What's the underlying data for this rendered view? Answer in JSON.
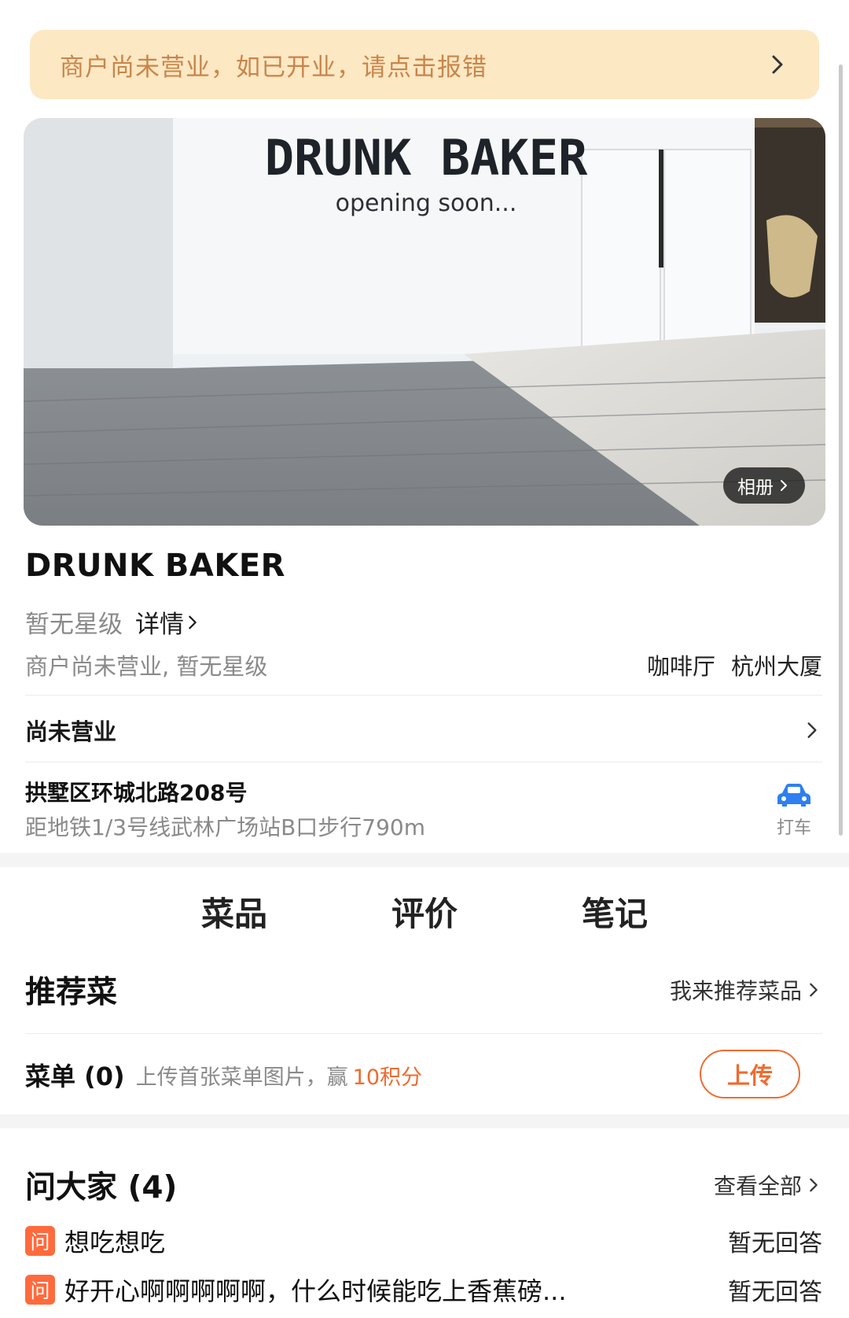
{
  "notice": {
    "text": "商户尚未营业，如已开业，请点击报错"
  },
  "hero": {
    "sign_title": "DRUNK BAKER",
    "sign_subtitle": "opening soon...",
    "album_label": "相册"
  },
  "shop": {
    "name": "DRUNK BAKER",
    "star_text": "暂无星级",
    "detail_label": "详情",
    "status_line": "商户尚未营业, 暂无星级",
    "tags": [
      "咖啡厅",
      "杭州大厦"
    ]
  },
  "business": {
    "status": "尚未营业"
  },
  "location": {
    "address": "拱墅区环城北路208号",
    "metro": "距地铁1/3号线武林广场站B口步行790m",
    "taxi_label": "打车"
  },
  "tabs": [
    {
      "label": "菜品",
      "active": true
    },
    {
      "label": "评价",
      "active": false
    },
    {
      "label": "笔记",
      "active": false
    }
  ],
  "recommend": {
    "title": "推荐菜",
    "link": "我来推荐菜品"
  },
  "menu": {
    "title": "菜单 (0)",
    "hint": "上传首张菜单图片，赢",
    "points": "10积分",
    "upload_label": "上传"
  },
  "qa": {
    "title": "问大家 (4)",
    "view_all": "查看全部",
    "badge": "问",
    "items": [
      {
        "question": "想吃想吃",
        "answer": "暂无回答"
      },
      {
        "question": "好开心啊啊啊啊啊，什么时候能吃上香蕉磅...",
        "answer": "暂无回答"
      }
    ]
  },
  "colors": {
    "notice_bg": "#fde8c4",
    "notice_text": "#c9854a",
    "accent": "#ef6b2f",
    "taxi_blue": "#2e7ff0"
  }
}
